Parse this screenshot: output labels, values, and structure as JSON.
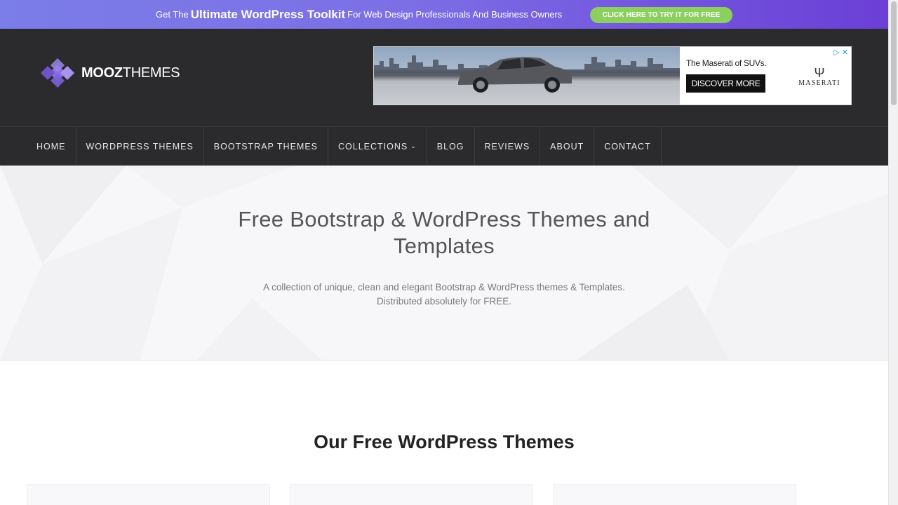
{
  "promo": {
    "prefix": "Get The",
    "highlight": "Ultimate WordPress Toolkit",
    "suffix": "For Web Design Professionals And Business Owners",
    "cta": "CLICK HERE TO TRY IT FOR FREE"
  },
  "logo": {
    "bold": "MOOZ",
    "light": "THEMES"
  },
  "ad": {
    "headline": "The Maserati of SUVs.",
    "button": "DISCOVER MORE",
    "brand": "MASERATI"
  },
  "nav": {
    "items": [
      {
        "label": "HOME"
      },
      {
        "label": "WORDPRESS THEMES"
      },
      {
        "label": "BOOTSTRAP THEMES"
      },
      {
        "label": "COLLECTIONS"
      },
      {
        "label": "BLOG"
      },
      {
        "label": "REVIEWS"
      },
      {
        "label": "ABOUT"
      },
      {
        "label": "CONTACT"
      }
    ]
  },
  "hero": {
    "title_line1": "Free Bootstrap & WordPress Themes and",
    "title_line2": "Templates",
    "subtitle_line1": "A collection of unique, clean and elegant Bootstrap & WordPress themes & Templates.",
    "subtitle_line2": "Distributed absolutely for FREE."
  },
  "section": {
    "title": "Our Free WordPress Themes"
  },
  "colors": {
    "promo_gradient_start": "#7b7de8",
    "promo_gradient_end": "#6b3fd6",
    "cta_green": "#8bd05e",
    "header_bg": "#2b2b2d",
    "logo_purple": "#8a6fe0"
  }
}
